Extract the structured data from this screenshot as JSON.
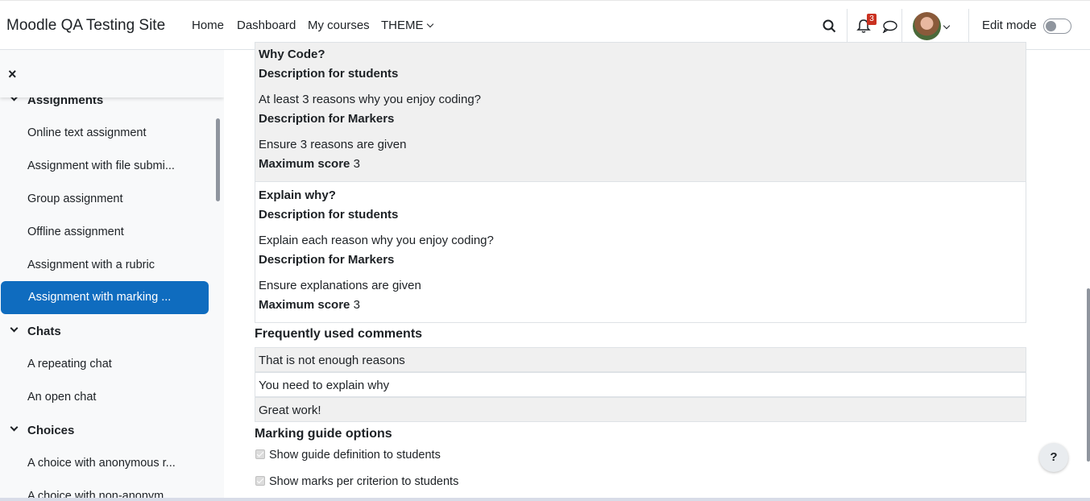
{
  "navbar": {
    "brand": "Moodle QA Testing Site",
    "links": [
      "Home",
      "Dashboard",
      "My courses",
      "THEME"
    ],
    "notification_count": "3",
    "edit_mode_label": "Edit mode",
    "edit_mode_on": false
  },
  "drawer": {
    "close_icon": "×",
    "sections": [
      {
        "title": "Assignments",
        "items": [
          "Online text assignment",
          "Assignment with file submi...",
          "Group assignment",
          "Offline assignment",
          "Assignment with a rubric",
          "Assignment with marking ..."
        ]
      },
      {
        "title": "Chats",
        "items": [
          "A repeating chat",
          "An open chat"
        ]
      },
      {
        "title": "Choices",
        "items": [
          "A choice with anonymous r...",
          "A choice with non-anonym..."
        ]
      }
    ],
    "active_item": "Assignment with marking ..."
  },
  "criteria": [
    {
      "name": "Why Code?",
      "desc_students_label": "Description for students",
      "desc_students": "At least 3 reasons why you enjoy coding?",
      "desc_markers_label": "Description for Markers",
      "desc_markers": "Ensure 3 reasons are given",
      "max_label": "Maximum score",
      "max_score": "3"
    },
    {
      "name": "Explain why?",
      "desc_students_label": "Description for students",
      "desc_students": "Explain each reason why you enjoy coding?",
      "desc_markers_label": "Description for Markers",
      "desc_markers": "Ensure explanations are given",
      "max_label": "Maximum score",
      "max_score": "3"
    }
  ],
  "comments": {
    "title": "Frequently used comments",
    "items": [
      "That is not enough reasons",
      "You need to explain why",
      "Great work!"
    ]
  },
  "options": {
    "title": "Marking guide options",
    "items": [
      {
        "label": "Show guide definition to students",
        "checked": true
      },
      {
        "label": "Show marks per criterion to students",
        "checked": true
      }
    ]
  },
  "help_label": "?"
}
